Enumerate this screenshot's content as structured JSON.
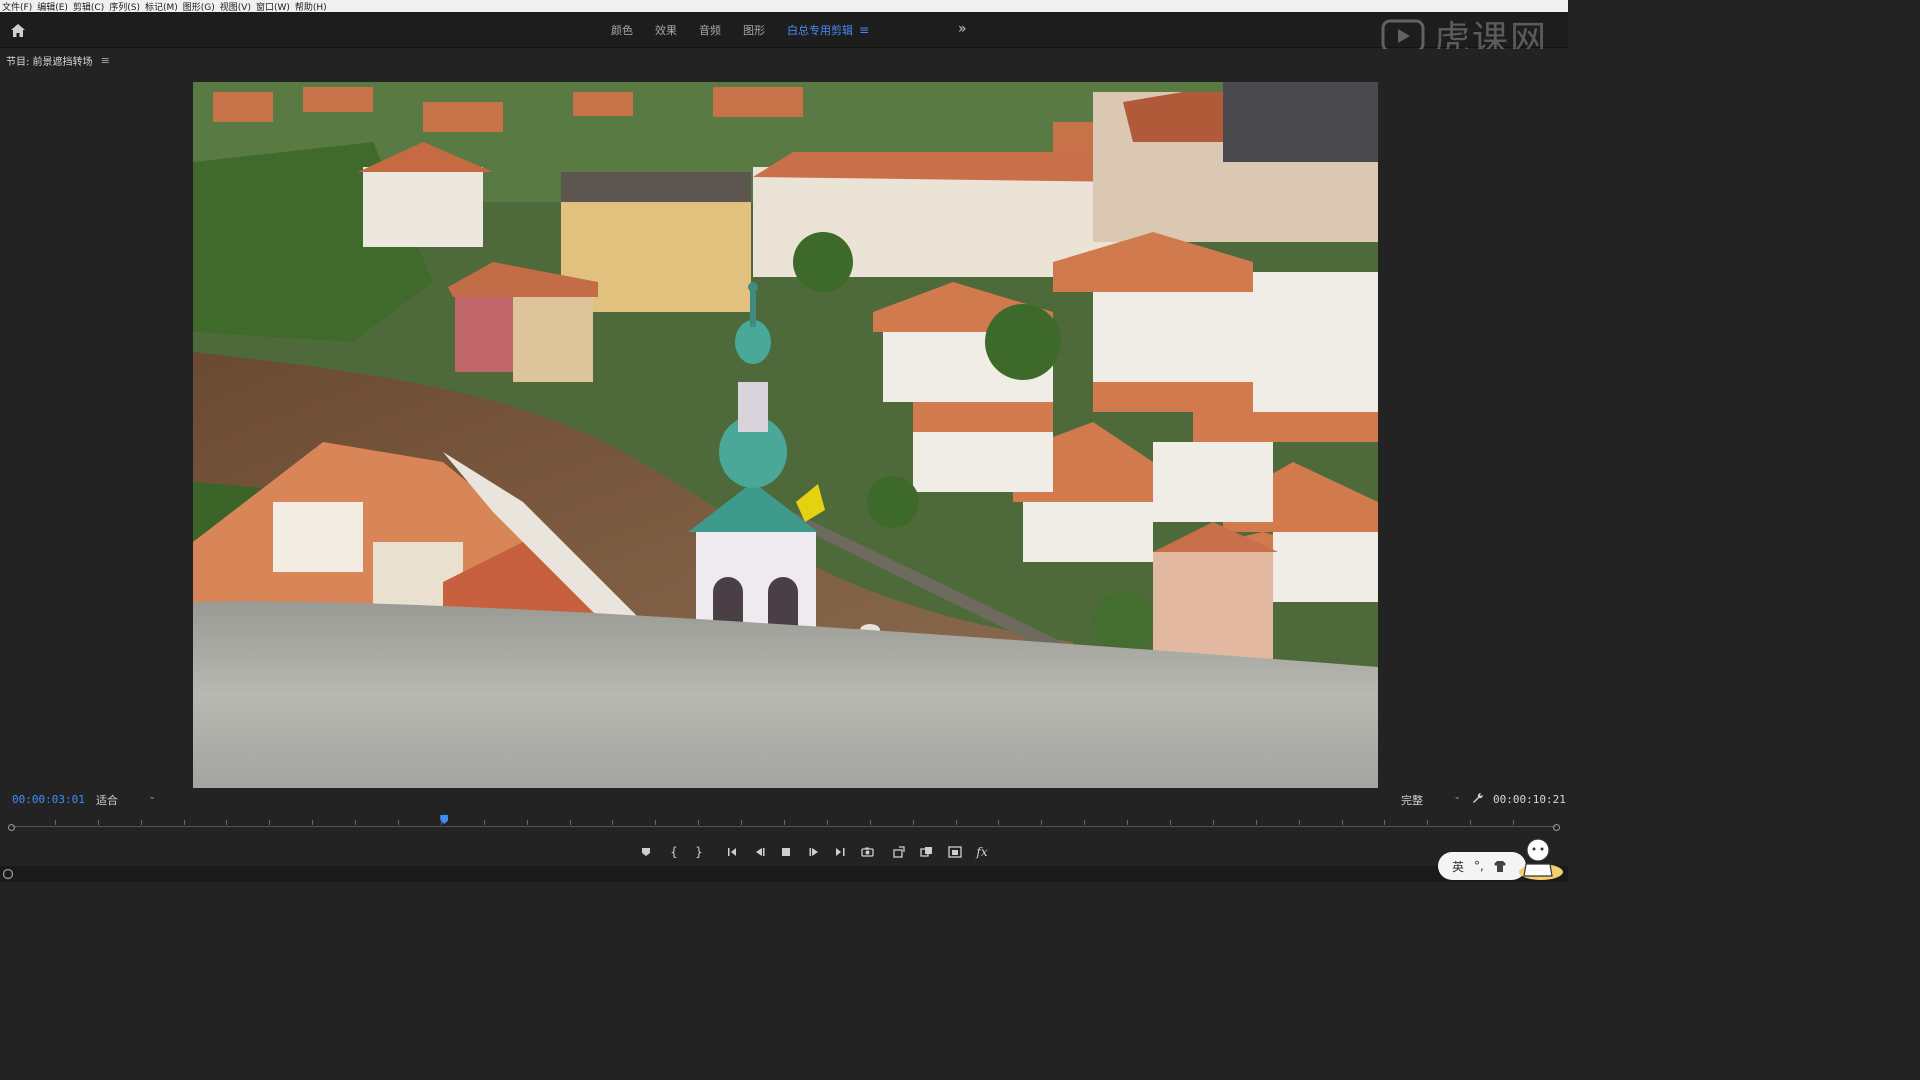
{
  "menu": [
    "文件(F)",
    "编辑(E)",
    "剪辑(C)",
    "序列(S)",
    "标记(M)",
    "图形(G)",
    "视图(V)",
    "窗口(W)",
    "帮助(H)"
  ],
  "workspaces": {
    "tabs": [
      "颜色",
      "效果",
      "音频",
      "图形",
      "白总专用剪辑"
    ],
    "active_index": 4,
    "more": "»"
  },
  "watermark": {
    "text": "虎课网"
  },
  "panel": {
    "title": "节目: 前景遮挡转场",
    "menu_icon": "≡"
  },
  "monitor": {
    "current_timecode": "00:00:03:01",
    "duration_timecode": "00:00:10:21",
    "zoom_option": "适合",
    "quality_option": "完整",
    "playhead_progress": 0.28
  },
  "transport_icons": [
    "add-marker-icon",
    "mark-in-icon",
    "mark-out-icon",
    "go-to-in-icon",
    "step-back-icon",
    "stop-icon",
    "step-forward-icon",
    "go-to-out-icon",
    "export-frame-icon",
    "lift-icon",
    "extract-icon",
    "comparison-view-icon",
    "fx-icon"
  ],
  "ime": {
    "lang": "英",
    "punct": "°,"
  }
}
